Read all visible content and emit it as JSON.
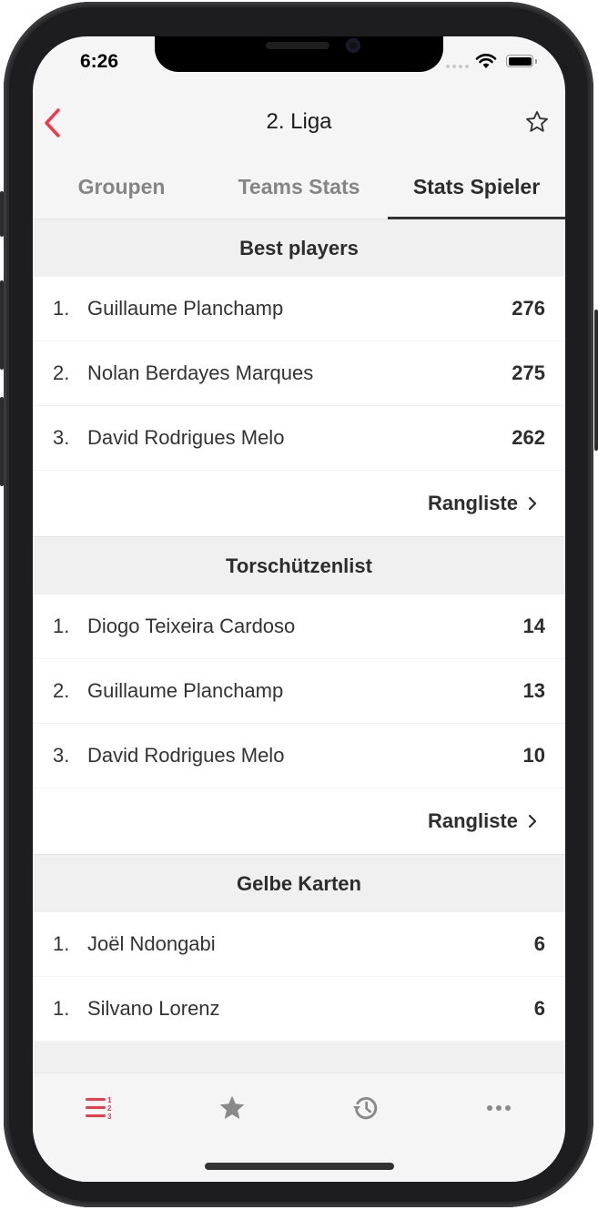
{
  "status_bar": {
    "time": "6:26"
  },
  "navbar": {
    "title": "2. Liga",
    "back_icon": "chevron-left-icon",
    "favorite_icon": "star-outline-icon"
  },
  "colors": {
    "accent": "#f0394b",
    "text": "#2d2d2d",
    "inactive": "#858585"
  },
  "tabs": [
    {
      "label": "Groupen",
      "active": false
    },
    {
      "label": "Teams Stats",
      "active": false
    },
    {
      "label": "Stats Spieler",
      "active": true
    }
  ],
  "sections": [
    {
      "title": "Best players",
      "rows": [
        {
          "rank": "1.",
          "name": "Guillaume Planchamp",
          "value": "276"
        },
        {
          "rank": "2.",
          "name": "Nolan Berdayes Marques",
          "value": "275"
        },
        {
          "rank": "3.",
          "name": "David Rodrigues Melo",
          "value": "262"
        }
      ],
      "more_label": "Rangliste"
    },
    {
      "title": "Torschützenlist",
      "rows": [
        {
          "rank": "1.",
          "name": "Diogo Teixeira Cardoso",
          "value": "14"
        },
        {
          "rank": "2.",
          "name": "Guillaume Planchamp",
          "value": "13"
        },
        {
          "rank": "3.",
          "name": "David Rodrigues Melo",
          "value": "10"
        }
      ],
      "more_label": "Rangliste"
    },
    {
      "title": "Gelbe Karten",
      "rows": [
        {
          "rank": "1.",
          "name": "Joël Ndongabi",
          "value": "6"
        },
        {
          "rank": "1.",
          "name": "Silvano Lorenz",
          "value": "6"
        }
      ]
    }
  ],
  "tabbar": [
    {
      "icon": "ranking-list-icon",
      "active": true
    },
    {
      "icon": "star-icon",
      "active": false
    },
    {
      "icon": "history-icon",
      "active": false
    },
    {
      "icon": "more-icon",
      "active": false
    }
  ]
}
